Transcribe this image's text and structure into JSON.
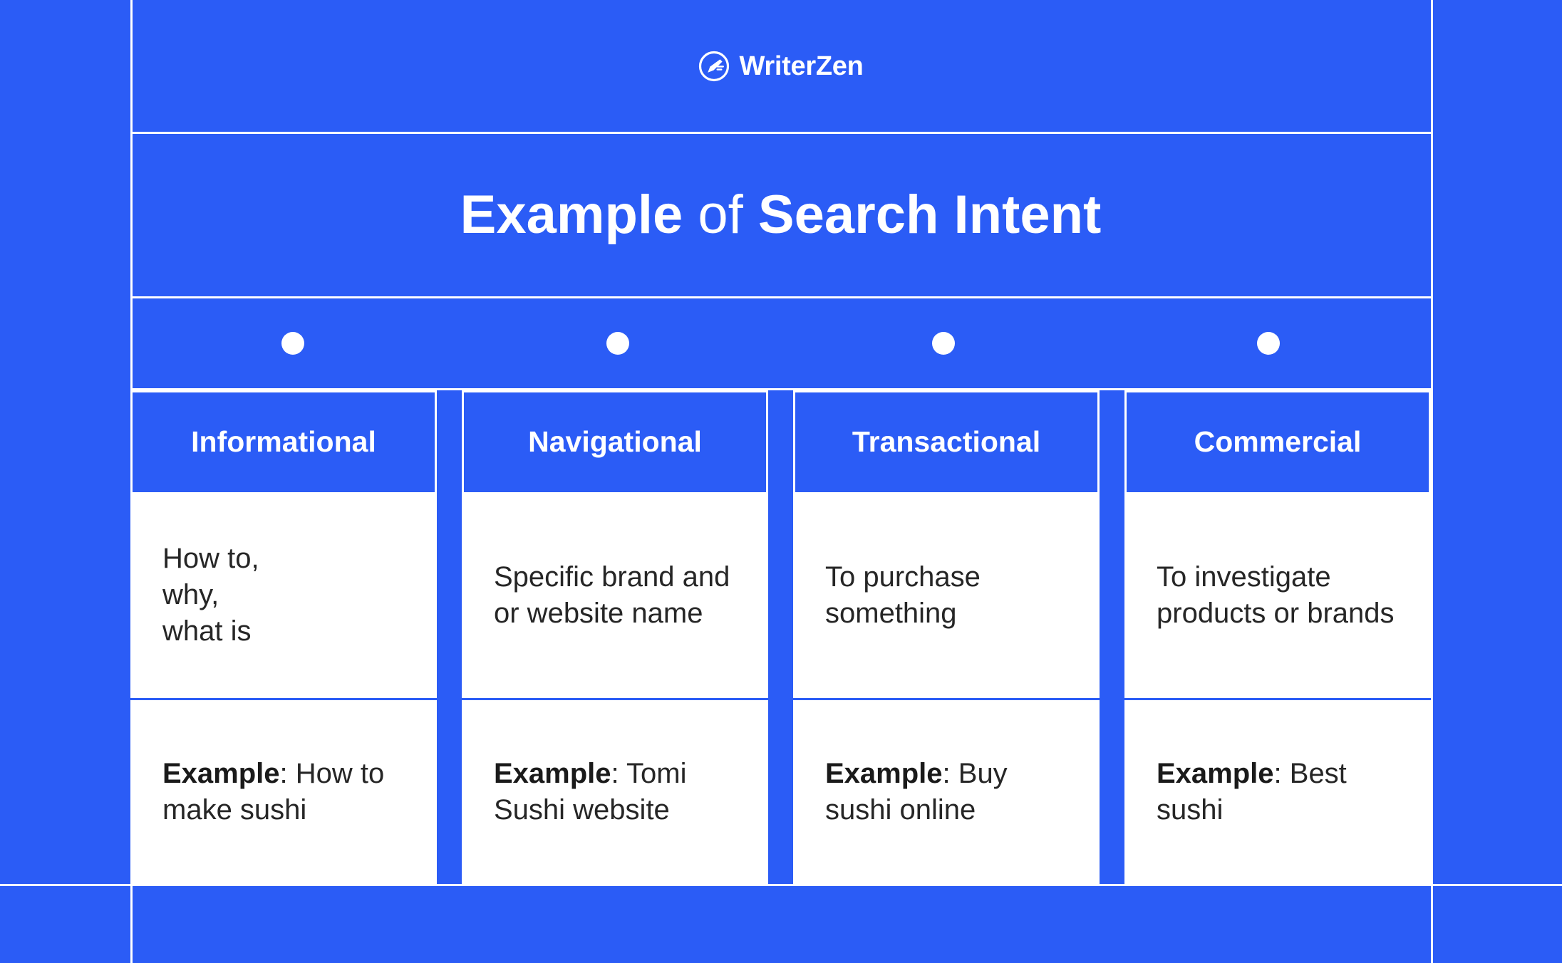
{
  "colors": {
    "background_blue": "#2b5cf6",
    "card_white": "#ffffff",
    "body_text": "#262626"
  },
  "brand": {
    "logo_icon": "pen-in-circle-icon",
    "name": "WriterZen"
  },
  "title": {
    "part1": "Example",
    "part2": "of",
    "part3": "Search Intent",
    "full": "Example of Search Intent"
  },
  "dots": [
    {
      "name": "informational"
    },
    {
      "name": "navigational"
    },
    {
      "name": "transactional"
    },
    {
      "name": "commercial"
    }
  ],
  "columns": [
    {
      "header": "Informational",
      "description": "How to,\nwhy,\nwhat is",
      "example_label": "Example",
      "example_separator": ": ",
      "example_value": "How to make sushi"
    },
    {
      "header": "Navigational",
      "description": "Specific brand and or website name",
      "example_label": "Example",
      "example_separator": ": ",
      "example_value": "Tomi Sushi website"
    },
    {
      "header": "Transactional",
      "description": "To purchase something",
      "example_label": "Example",
      "example_separator": ": ",
      "example_value": "Buy sushi online"
    },
    {
      "header": "Commercial",
      "description": "To investigate products or brands",
      "example_label": "Example",
      "example_separator": ": ",
      "example_value": "Best sushi"
    }
  ]
}
